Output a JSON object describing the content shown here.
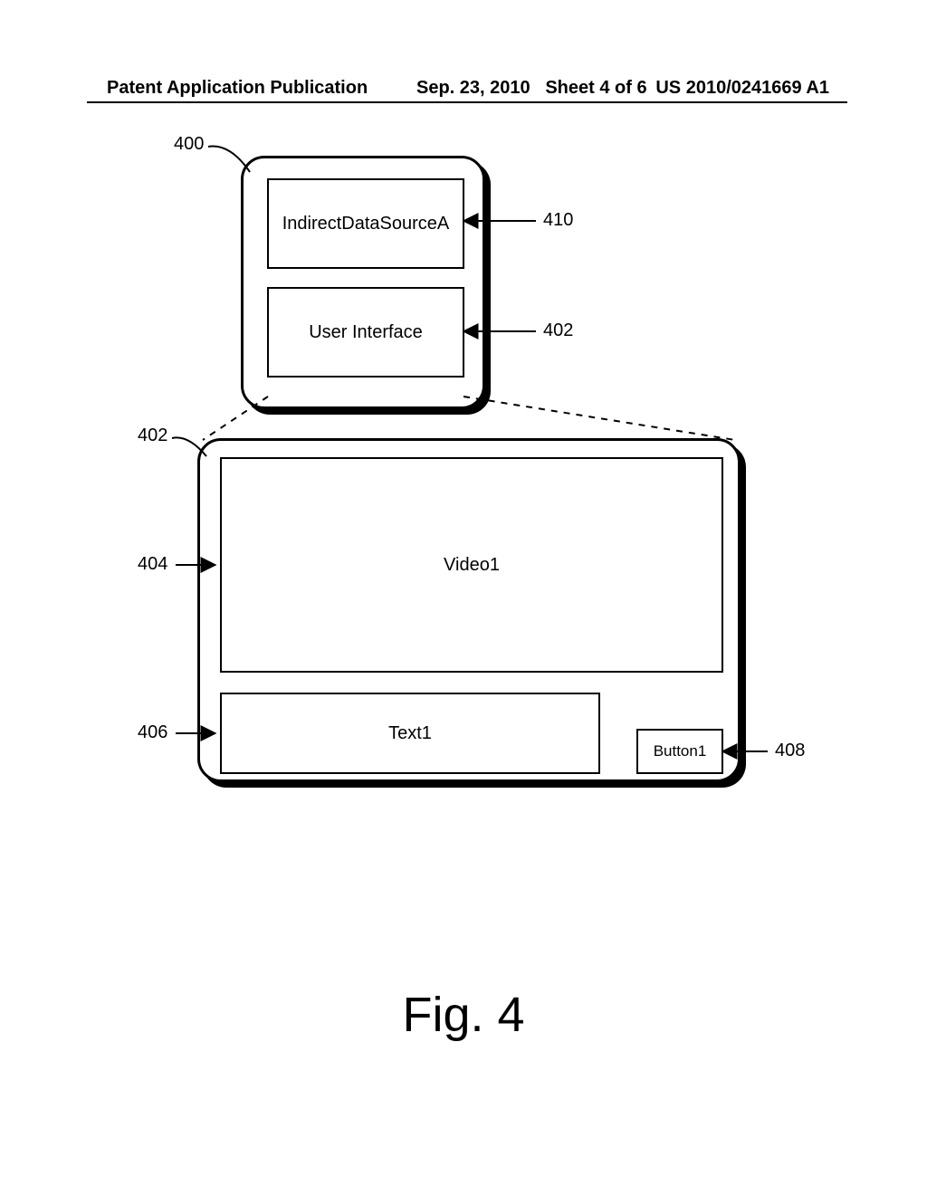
{
  "header": {
    "left": "Patent Application Publication",
    "date": "Sep. 23, 2010",
    "sheet": "Sheet 4 of 6",
    "right": "US 2010/0241669 A1"
  },
  "top_panel": {
    "box1": "IndirectDataSourceA",
    "box2": "User Interface"
  },
  "bottom_panel": {
    "video": "Video1",
    "text": "Text1",
    "button": "Button1"
  },
  "refs": {
    "r400": "400",
    "r410": "410",
    "r402a": "402",
    "r402b": "402",
    "r404": "404",
    "r406": "406",
    "r408": "408"
  },
  "figure_caption": "Fig. 4"
}
